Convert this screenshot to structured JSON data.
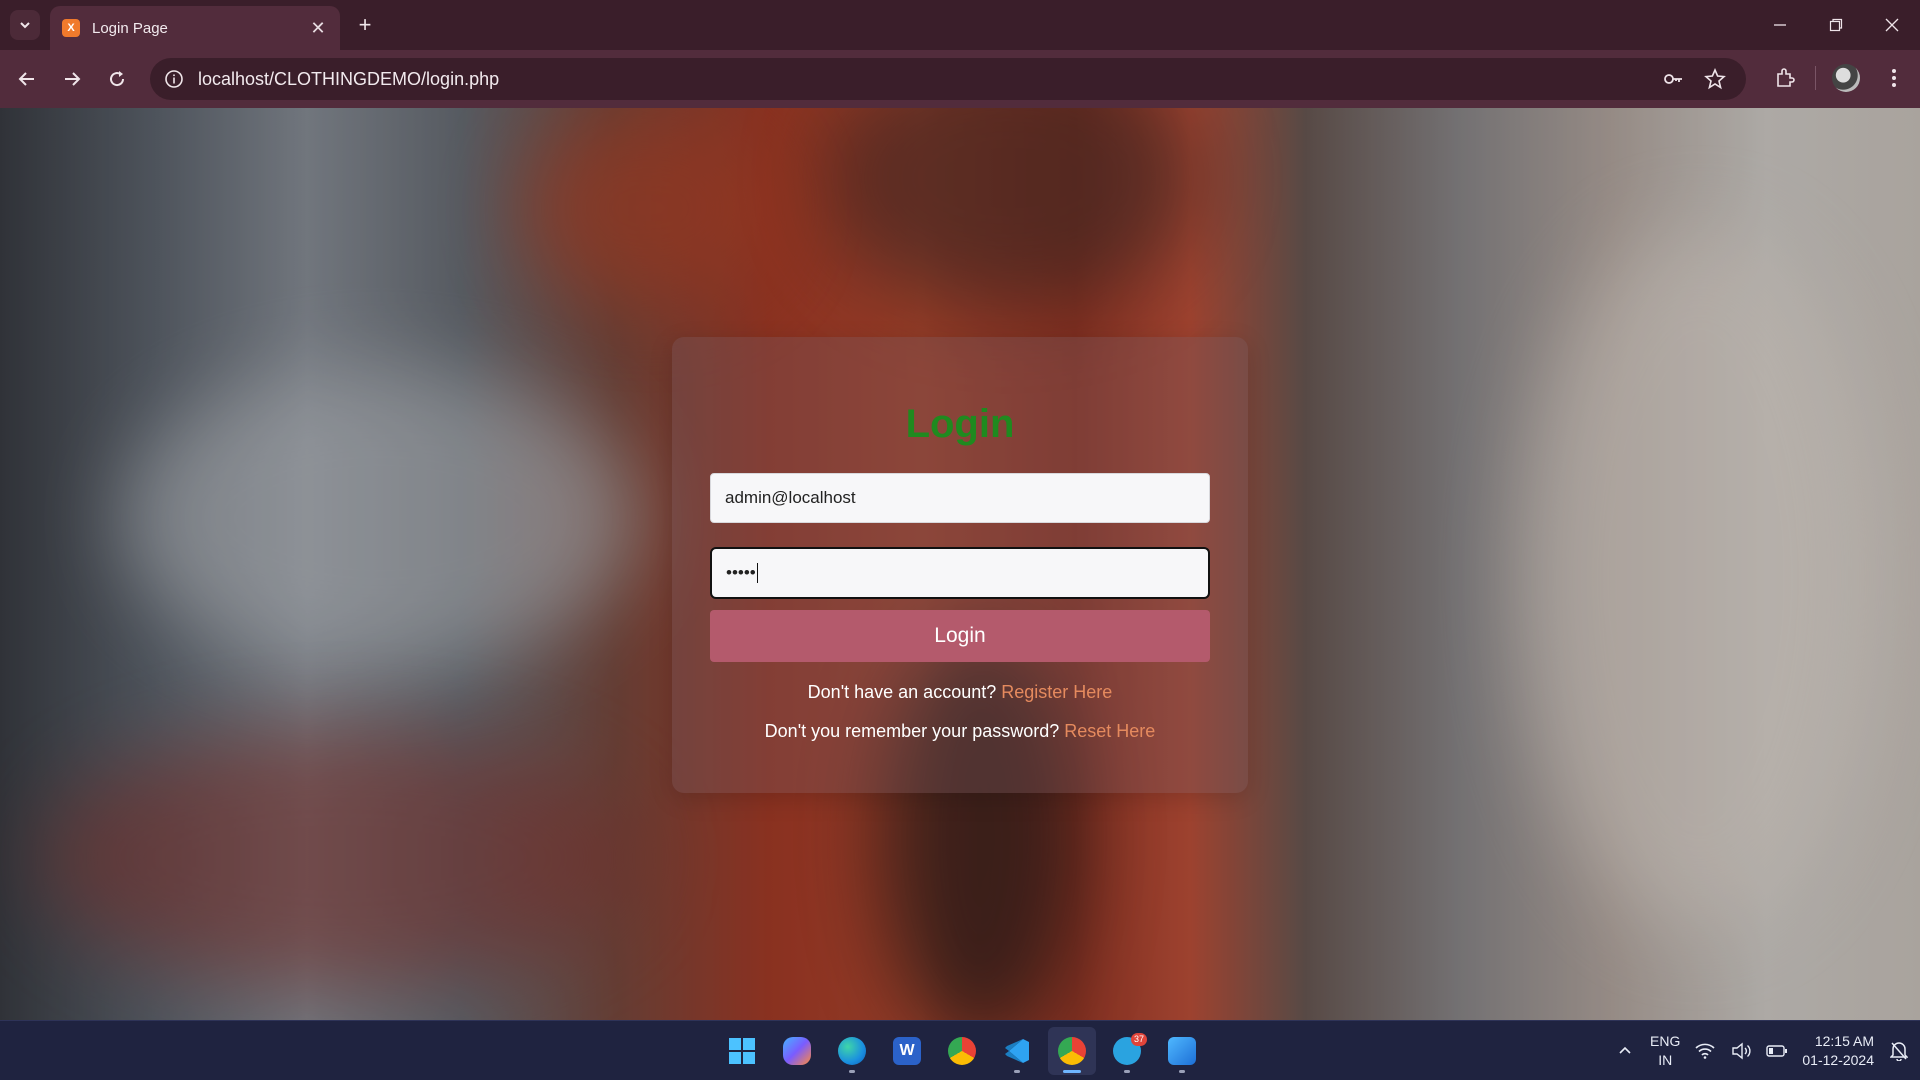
{
  "browser": {
    "tab_title": "Login Page",
    "favicon_label": "X",
    "url": "localhost/CLOTHINGDEMO/login.php"
  },
  "login": {
    "title": "Login",
    "email_value": "admin@localhost",
    "password_masked": "•••••",
    "button_label": "Login",
    "register_prompt": "Don't have an account?",
    "register_link": "Register Here",
    "reset_prompt": "Don't you remember your password?",
    "reset_link": "Reset Here"
  },
  "taskbar": {
    "apps": [
      "start-icon",
      "copilot-icon",
      "edge-icon",
      "word-icon",
      "chrome-icon",
      "vscode-icon",
      "chrome-profile-icon",
      "telegram-icon",
      "photos-icon"
    ],
    "telegram_badge": "37",
    "lang_top": "ENG",
    "lang_bottom": "IN",
    "time": "12:15 AM",
    "date": "01-12-2024"
  },
  "colors": {
    "title_green": "#1f8a1f",
    "button_rose": "#b45a6c",
    "link_orange": "#e58a5e"
  }
}
